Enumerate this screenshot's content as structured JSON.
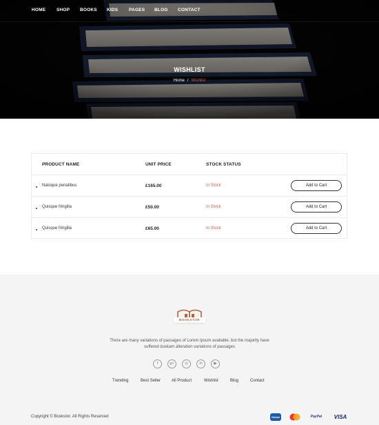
{
  "nav": {
    "items": [
      "HOME",
      "SHOP",
      "BOOKS",
      "KIDS",
      "PAGES",
      "BLOG",
      "CONTACT"
    ]
  },
  "hero": {
    "title": "WISHLIST",
    "breadcrumb_home": "Home",
    "breadcrumb_sep": "/",
    "breadcrumb_current": "Wishlist"
  },
  "wishlist": {
    "headers": [
      "PRODUCT NAME",
      "UNIT PRICE",
      "STOCK STATUS"
    ],
    "rows": [
      {
        "name": "Natoque penatibus",
        "price": "£165.00",
        "stock": "In Stock",
        "button": "Add to Cart"
      },
      {
        "name": "Quisque fringilla",
        "price": "£50.00",
        "stock": "In Stock",
        "button": "Add to Cart"
      },
      {
        "name": "Quisque fringilla",
        "price": "£65.00",
        "stock": "In Stock",
        "button": "Add to Cart"
      }
    ]
  },
  "footer": {
    "logo_text": "BOOKSTOR",
    "description_line1": "There are many variations of passages of Lorem Ipsum available, but the majority have",
    "description_line2": "suffered duskam alteration variations of passages",
    "social": [
      {
        "icon": "facebook-icon",
        "glyph": "f"
      },
      {
        "icon": "google-plus-icon",
        "glyph": "g+"
      },
      {
        "icon": "instagram-icon",
        "glyph": "◎"
      },
      {
        "icon": "linkedin-icon",
        "glyph": "in"
      },
      {
        "icon": "youtube-icon",
        "glyph": "▶"
      }
    ],
    "links": [
      "Trending",
      "Best Seller",
      "All Product",
      "Wishlist",
      "Blog",
      "Contact"
    ],
    "copyright": "Copyright © Bookstor. All Rights Reserved",
    "payments": [
      "Omise",
      "MC",
      "PayPal",
      "VISA"
    ]
  },
  "colors": {
    "accent": "#d4624a",
    "hero_bg": "#050505",
    "footer_bg": "#f4f4f4"
  }
}
